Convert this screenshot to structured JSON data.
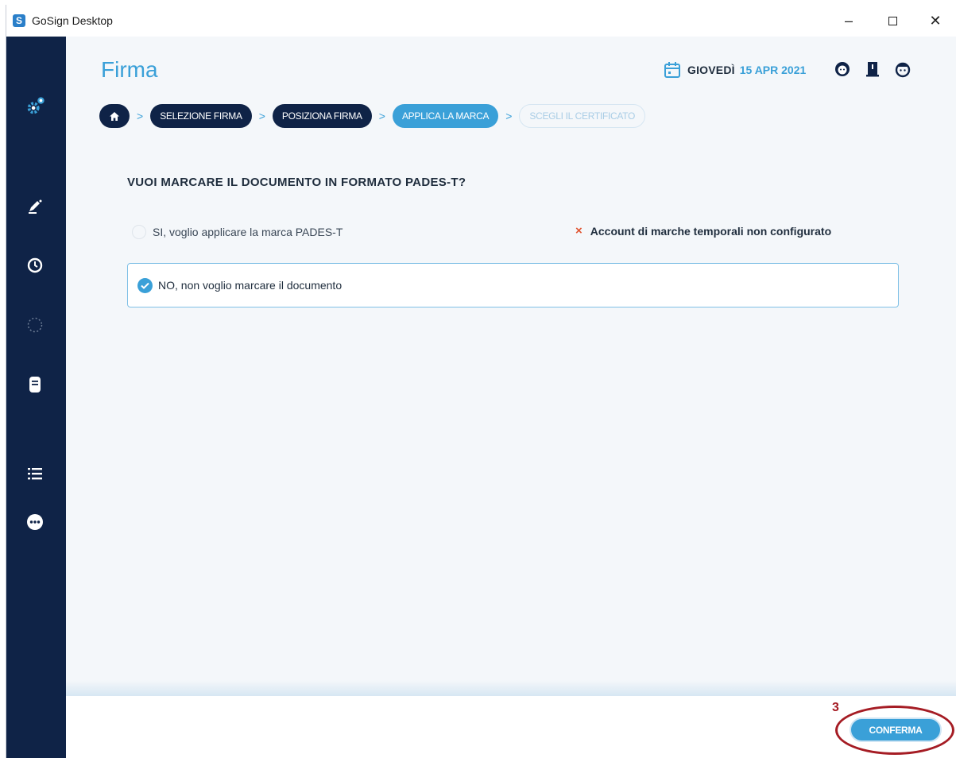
{
  "window": {
    "app_icon_letter": "S",
    "title": "GoSign Desktop",
    "min_glyph": "–",
    "close_glyph": "✕"
  },
  "header": {
    "title": "Firma",
    "day": "GIOVEDÌ",
    "date": "15 APR 2021"
  },
  "breadcrumb": {
    "steps": [
      {
        "label": "SELEZIONE FIRMA",
        "state": "done"
      },
      {
        "label": "POSIZIONA FIRMA",
        "state": "done"
      },
      {
        "label": "APPLICA LA MARCA",
        "state": "active"
      },
      {
        "label": "SCEGLI IL CERTIFICATO",
        "state": "todo"
      }
    ],
    "separator": ">"
  },
  "main": {
    "question": "VUOI MARCARE IL DOCUMENTO IN FORMATO PADES-T?",
    "option_yes": "SI, voglio applicare la marca PADES-T",
    "error_glyph": "×",
    "error_text": "Account di marche temporali non configurato",
    "option_no": "NO, non voglio marcare il documento"
  },
  "footer": {
    "confirm_label": "CONFERMA",
    "annotation_number": "3"
  },
  "colors": {
    "sidebar": "#0f2347",
    "accent": "#3aa0d8",
    "error": "#e0532f",
    "annotation": "#a51c24"
  },
  "icons": {
    "sidebar": [
      "settings-gear-icon",
      "sign-pen-icon",
      "clock-icon",
      "loading-circle-icon",
      "device-icon",
      "checklist-icon",
      "more-icon"
    ],
    "header": [
      "calendar-icon",
      "user-avatar-icon",
      "notebook-icon",
      "profile-icon"
    ]
  }
}
